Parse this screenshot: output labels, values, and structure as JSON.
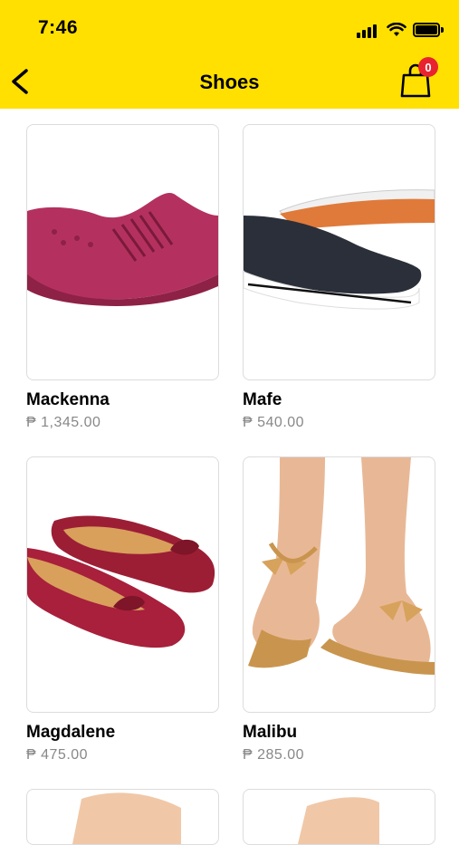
{
  "status_bar": {
    "time": "7:46"
  },
  "header": {
    "title": "Shoes",
    "cart_count": "0",
    "background": "#FFE000"
  },
  "products": [
    {
      "name": "Mackenna",
      "price": "₱ 1,345.00",
      "image": "pink-knit-sneaker"
    },
    {
      "name": "Mafe",
      "price": "₱ 540.00",
      "image": "black-slip-on"
    },
    {
      "name": "Magdalene",
      "price": "₱ 475.00",
      "image": "red-bow-loafers"
    },
    {
      "name": "Malibu",
      "price": "₱ 285.00",
      "image": "tan-bow-sandals"
    },
    {
      "name": "",
      "price": "",
      "image": "partial-card"
    },
    {
      "name": "",
      "price": "",
      "image": "partial-card"
    }
  ],
  "colors": {
    "badge": "#E8232F",
    "price": "#888888"
  }
}
